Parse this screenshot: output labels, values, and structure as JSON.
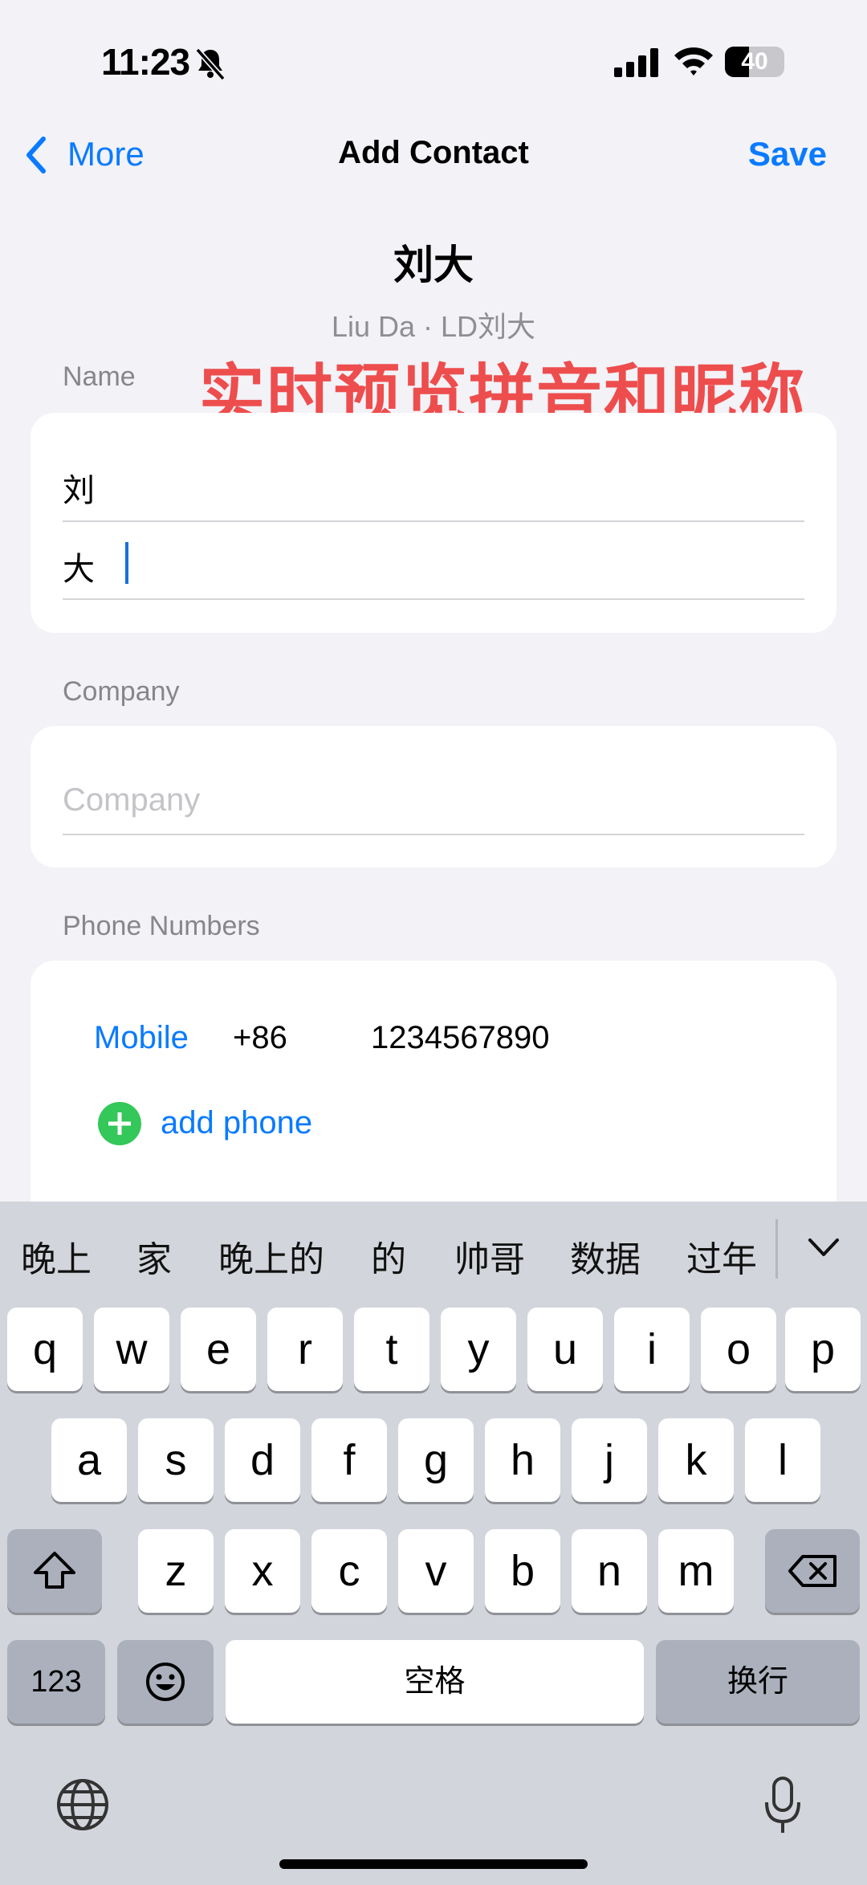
{
  "status_bar": {
    "time": "11:23",
    "battery_level": "40",
    "battery_fraction": 0.4
  },
  "nav": {
    "back_label": "More",
    "title": "Add Contact",
    "save_label": "Save"
  },
  "preview": {
    "name": "刘大",
    "subtitle": "Liu Da  ·  LD刘大"
  },
  "annotation": "实时预览拼音和昵称",
  "sections": {
    "name": {
      "label": "Name",
      "first": "刘",
      "last": "大"
    },
    "company": {
      "label": "Company",
      "placeholder": "Company"
    },
    "phone": {
      "label": "Phone Numbers",
      "type": "Mobile",
      "country_code": "+86",
      "number": "1234567890",
      "add_label": "add phone"
    }
  },
  "keyboard": {
    "candidates": [
      "晚上",
      "家",
      "晚上的",
      "的",
      "帅哥",
      "数据",
      "过年"
    ],
    "row1": [
      "q",
      "w",
      "e",
      "r",
      "t",
      "y",
      "u",
      "i",
      "o",
      "p"
    ],
    "row2": [
      "a",
      "s",
      "d",
      "f",
      "g",
      "h",
      "j",
      "k",
      "l"
    ],
    "row3": [
      "z",
      "x",
      "c",
      "v",
      "b",
      "n",
      "m"
    ],
    "numbers_key": "123",
    "space_label": "空格",
    "return_label": "换行"
  },
  "colors": {
    "accent": "#0a7aff",
    "annotation": "#ee4d4d",
    "add_green": "#34c759"
  }
}
